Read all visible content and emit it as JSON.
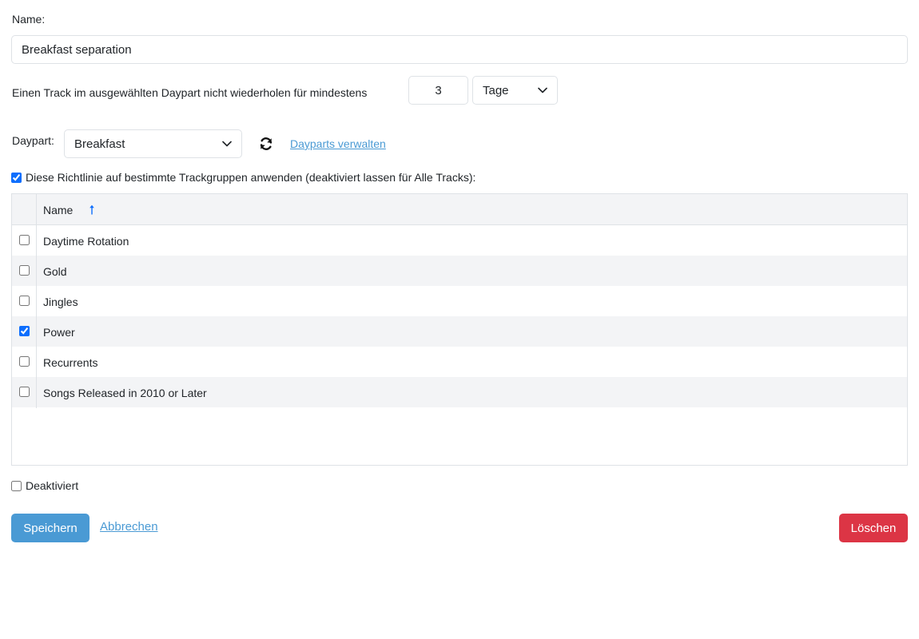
{
  "form": {
    "name_label": "Name:",
    "name_value": "Breakfast separation",
    "repeat_text": "Einen Track im ausgewählten Daypart nicht wiederholen für mindestens",
    "repeat_value": "3",
    "repeat_unit": "Tage",
    "daypart_label": "Daypart:",
    "daypart_value": "Breakfast",
    "manage_dayparts_link": "Dayparts verwalten",
    "apply_groups_label": "Diese Richtlinie auf bestimmte Trackgruppen anwenden (deaktiviert lassen für Alle Tracks):",
    "apply_groups_checked": true,
    "disabled_label": "Deaktiviert",
    "disabled_checked": false
  },
  "table": {
    "column_header": "Name",
    "sort_direction": "ascending",
    "rows": [
      {
        "name": "Daytime Rotation",
        "checked": false
      },
      {
        "name": "Gold",
        "checked": false
      },
      {
        "name": "Jingles",
        "checked": false
      },
      {
        "name": "Power",
        "checked": true
      },
      {
        "name": "Recurrents",
        "checked": false
      },
      {
        "name": "Songs Released in 2010 or Later",
        "checked": false
      }
    ]
  },
  "actions": {
    "save_label": "Speichern",
    "cancel_label": "Abbrechen",
    "delete_label": "Löschen"
  },
  "colors": {
    "primary": "#4a9ad4",
    "danger": "#dc3545",
    "stripe": "#f3f4f6",
    "border": "#dee2e6"
  },
  "icons": {
    "refresh": "refresh-icon",
    "sort": "sort-ascending-icon",
    "dropdown": "chevron-down-icon"
  }
}
